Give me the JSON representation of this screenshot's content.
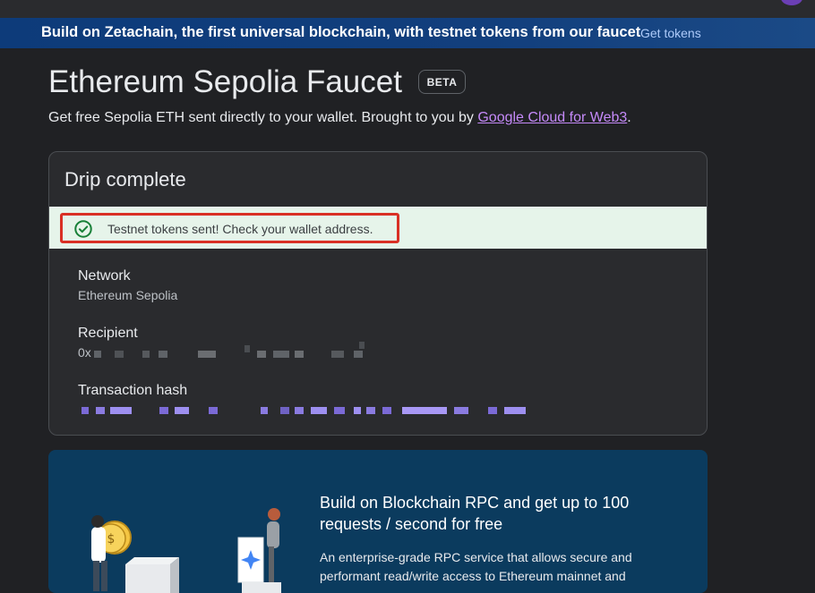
{
  "banner": {
    "text": "Build on Zetachain, the first universal blockchain, with testnet tokens from our faucet",
    "link": "Get tokens"
  },
  "header": {
    "title": "Ethereum Sepolia Faucet",
    "badge": "BETA",
    "subtitle_prefix": "Get free Sepolia ETH sent directly to your wallet. Brought to you by ",
    "subtitle_link": "Google Cloud for Web3",
    "subtitle_suffix": "."
  },
  "drip": {
    "title": "Drip complete",
    "success_message": "Testnet tokens sent! Check your wallet address.",
    "fields": {
      "network_label": "Network",
      "network_value": "Ethereum Sepolia",
      "recipient_label": "Recipient",
      "recipient_prefix": "0x",
      "tx_label": "Transaction hash"
    }
  },
  "promo": {
    "title": "Build on Blockchain RPC and get up to 100 requests / second for free",
    "body": "An enterprise-grade RPC service that allows secure and performant read/write access to Ethereum mainnet and"
  },
  "colors": {
    "accent_link": "#c58af9",
    "success_bg": "#e6f4ea",
    "success_check": "#188038",
    "highlight_border": "#d93025",
    "promo_bg": "#0b3b5e"
  },
  "icons": {
    "success": "check-circle-icon",
    "promo_illustration": "people-coin-illustration"
  }
}
